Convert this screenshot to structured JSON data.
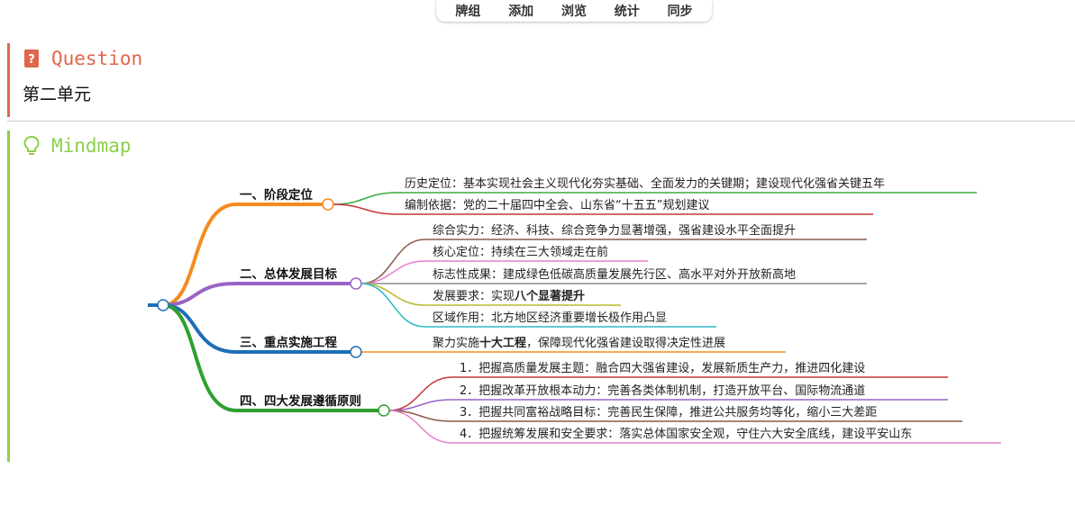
{
  "toolbar": {
    "items": [
      "牌组",
      "添加",
      "浏览",
      "统计",
      "同步"
    ]
  },
  "question": {
    "title": "Question",
    "body": "第二单元",
    "icon": "question-book-icon",
    "color": "#e0664b"
  },
  "mindmap": {
    "title": "Mindmap",
    "icon": "lightbulb-icon",
    "color": "#8ccf4a",
    "branches": [
      {
        "label": "一、阶段定位",
        "color": "#f58b1f",
        "children": [
          {
            "segments": [
              {
                "t": "历史定位：基本实现社会主义现代化夯实基础、全面发力的关键期；建设现代化强省关键五年"
              }
            ],
            "color": "#3aab3a"
          },
          {
            "segments": [
              {
                "t": "编制依据：党的二十届四中全会、山东省“十五五”规划建议"
              }
            ],
            "color": "#c8353a"
          }
        ]
      },
      {
        "label": "二、总体发展目标",
        "color": "#9a63c4",
        "children": [
          {
            "segments": [
              {
                "t": "综合实力：经济、科技、综合竞争力显著增强，强省建设水平全面提升"
              }
            ],
            "color": "#8b5a4a"
          },
          {
            "segments": [
              {
                "t": "核心定位：持续在三大领域走在前"
              }
            ],
            "color": "#e97dc8"
          },
          {
            "segments": [
              {
                "t": "标志性成果：建成绿色低碳高质量发展先行区、高水平对外开放新高地"
              }
            ],
            "color": "#8a8a8a"
          },
          {
            "segments": [
              {
                "t": "发展要求：实现"
              },
              {
                "t": "八个显著提升",
                "b": true
              }
            ],
            "color": "#b8bc2c"
          },
          {
            "segments": [
              {
                "t": "区域作用：北方地区经济重要增长极作用凸显"
              }
            ],
            "color": "#2bbcc6"
          }
        ]
      },
      {
        "label": "三、重点实施工程",
        "color": "#1f6fb5",
        "children": [
          {
            "segments": [
              {
                "t": "聚力实施"
              },
              {
                "t": "十大工程",
                "b": true
              },
              {
                "t": "，保障现代化强省建设取得决定性进展"
              }
            ],
            "color": "#f58b1f"
          }
        ]
      },
      {
        "label": "四、四大发展遵循原则",
        "color": "#2ea02e",
        "children": [
          {
            "segments": [
              {
                "t": "1．把握高质量发展主题：融合四大强省建设，发展新质生产力，推进四化建设"
              }
            ],
            "color": "#c8353a"
          },
          {
            "segments": [
              {
                "t": "2．把握改革开放根本动力：完善各类体制机制，打造开放平台、国际物流通道"
              }
            ],
            "color": "#9a63c4"
          },
          {
            "segments": [
              {
                "t": "3．把握共同富裕战略目标：完善民生保障，推进公共服务均等化，缩小三大差距"
              }
            ],
            "color": "#8b5a4a"
          },
          {
            "segments": [
              {
                "t": "4．把握统筹发展和安全要求：落实总体国家安全观，守住六大安全底线，建设平安山东"
              }
            ],
            "color": "#e97dc8"
          }
        ]
      }
    ]
  }
}
